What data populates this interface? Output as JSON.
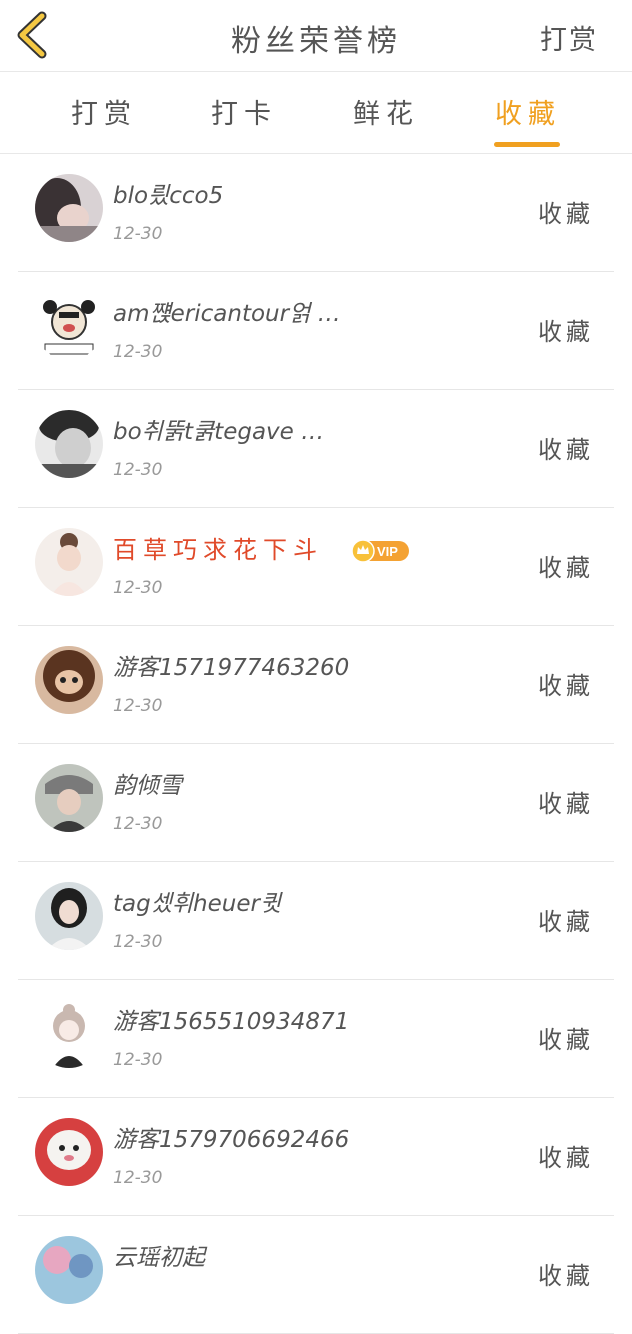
{
  "header": {
    "title": "粉丝荣誉榜",
    "action_label": "打赏"
  },
  "tabs": [
    {
      "label": "打赏"
    },
    {
      "label": "打卡"
    },
    {
      "label": "鲜花"
    },
    {
      "label": "收藏"
    }
  ],
  "active_tab": "收藏",
  "colors": {
    "accent": "#f0a020",
    "vip_name": "#e04a2a",
    "vip_badge": "#f4a233"
  },
  "rows": [
    {
      "name": "blo릤cco5",
      "date": "12-30",
      "action": "收藏"
    },
    {
      "name": "am쨵ericantour얽 …",
      "date": "12-30",
      "action": "收藏"
    },
    {
      "name": "bo취뚥t쿩tegave …",
      "date": "12-30",
      "action": "收藏"
    },
    {
      "name": "百草巧求花下斗",
      "date": "12-30",
      "action": "收藏",
      "badge": "VIP"
    },
    {
      "name": "游客1571977463260",
      "date": "12-30",
      "action": "收藏"
    },
    {
      "name": "韵倾雪",
      "date": "12-30",
      "action": "收藏"
    },
    {
      "name": "tag셌휘heuer큇",
      "date": "12-30",
      "action": "收藏"
    },
    {
      "name": "游客1565510934871",
      "date": "12-30",
      "action": "收藏"
    },
    {
      "name": "游客1579706692466",
      "date": "12-30",
      "action": "收藏"
    },
    {
      "name": "云瑶初起",
      "date": "",
      "action": "收藏"
    }
  ]
}
